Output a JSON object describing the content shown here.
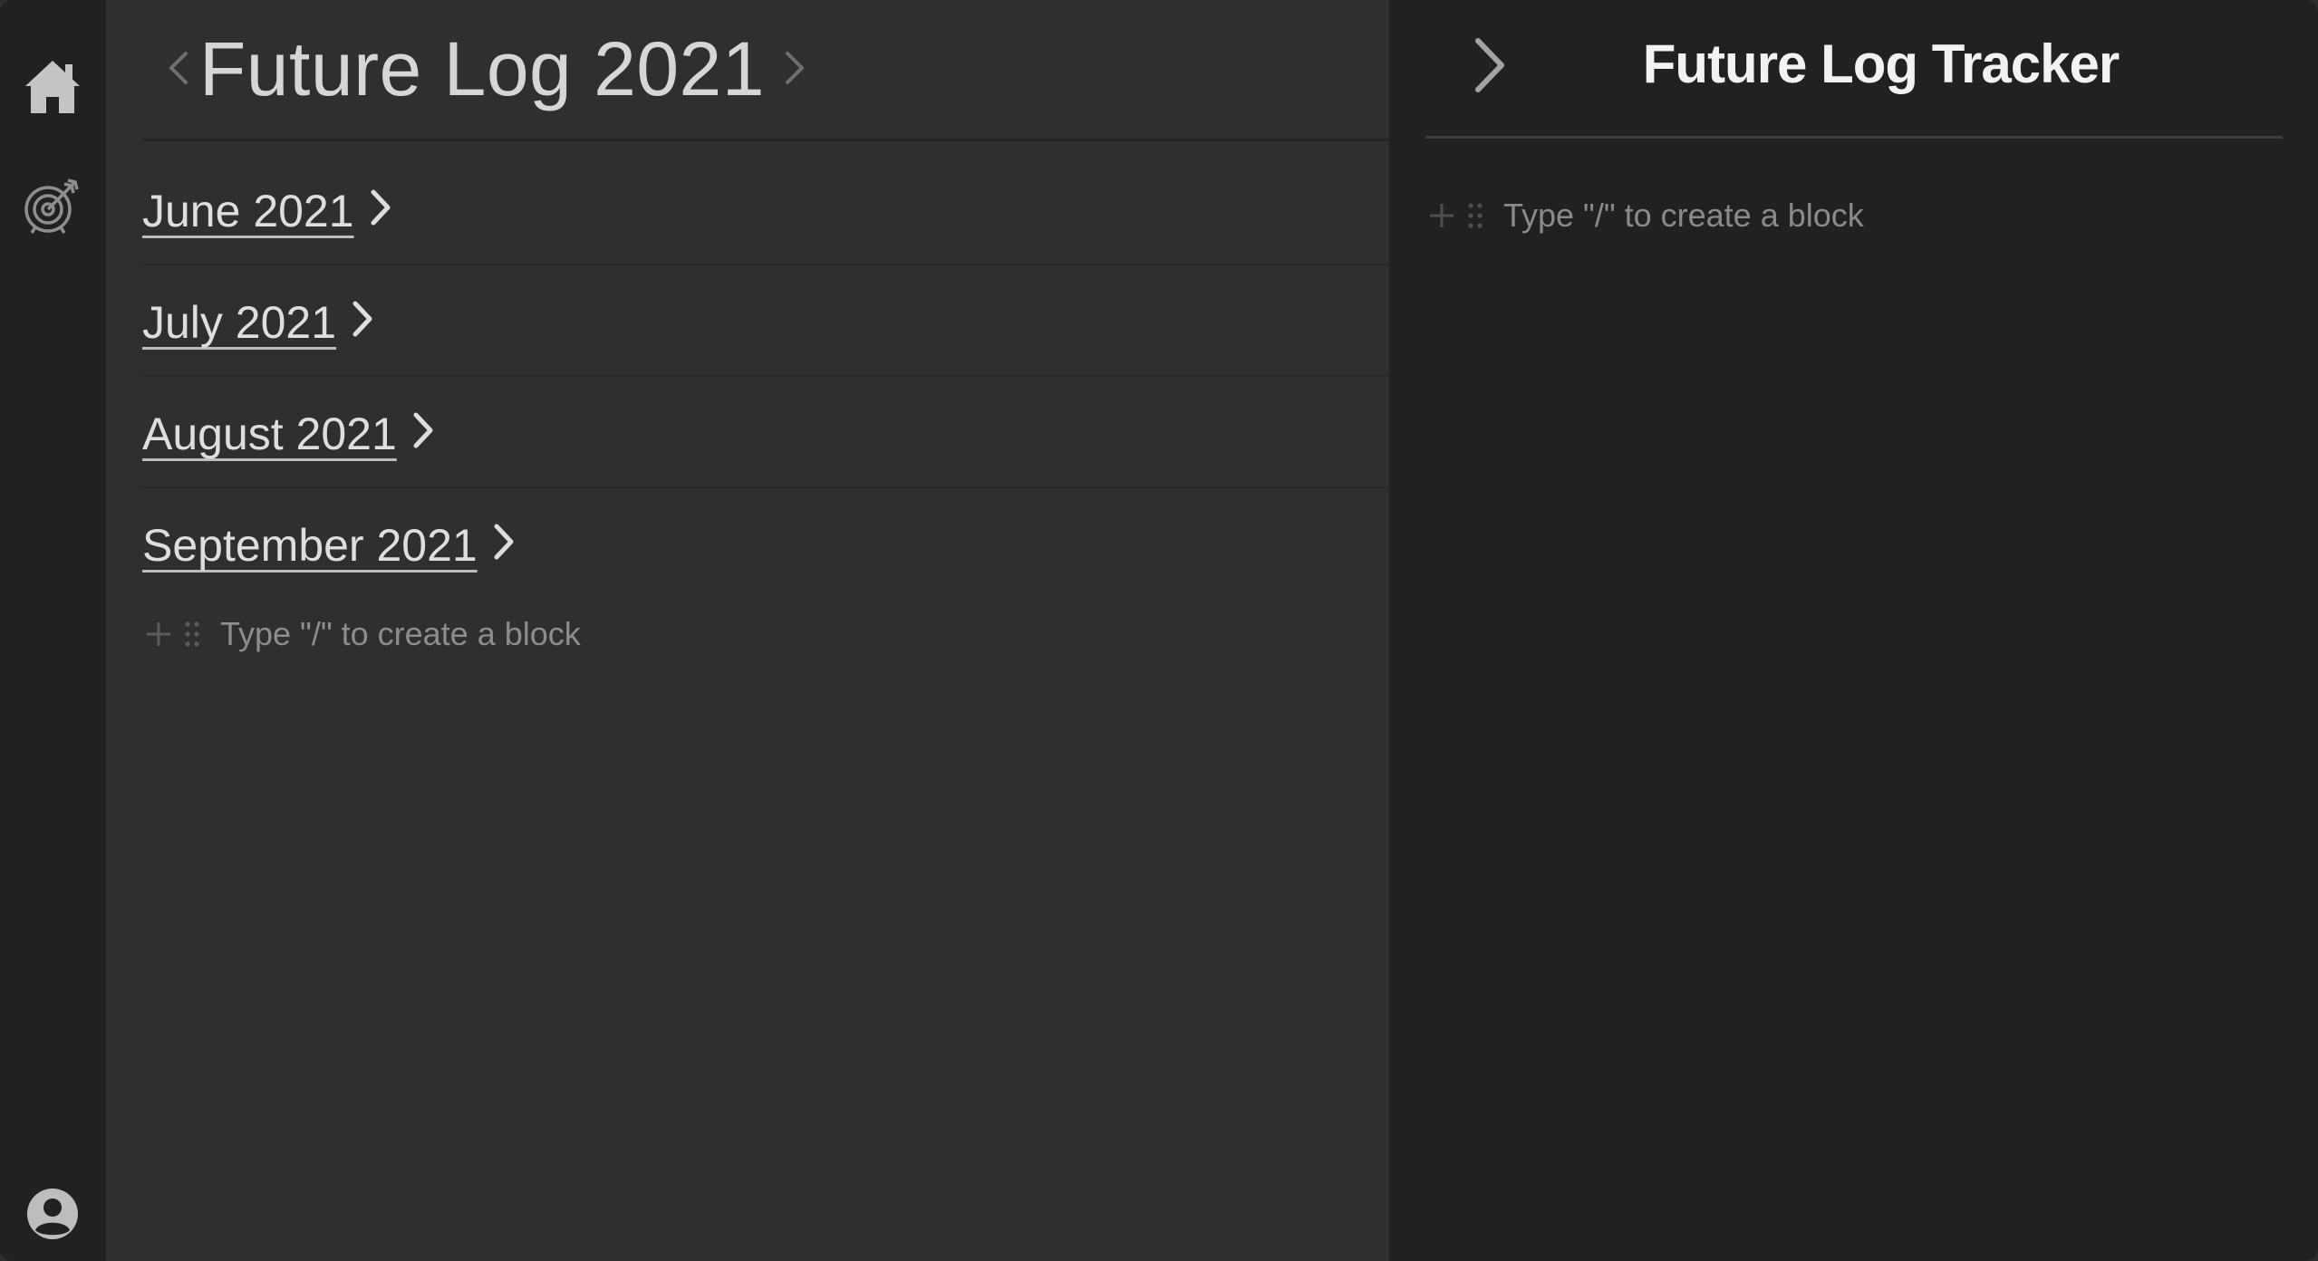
{
  "rail": {
    "icons": [
      "home-icon",
      "target-icon",
      "user-avatar-icon"
    ]
  },
  "page": {
    "title": "Future Log 2021",
    "months": [
      {
        "label": "June 2021"
      },
      {
        "label": "July 2021"
      },
      {
        "label": "August 2021"
      },
      {
        "label": "September 2021"
      }
    ],
    "block_placeholder": "Type \"/\" to create a block"
  },
  "panel": {
    "title": "Future Log Tracker",
    "block_placeholder": "Type \"/\" to create a block"
  },
  "colors": {
    "rail_bg": "#202121",
    "page_bg": "#2e2f2f",
    "panel_bg": "#202121",
    "text_primary": "#dedede",
    "text_muted": "#8d8d8d"
  }
}
